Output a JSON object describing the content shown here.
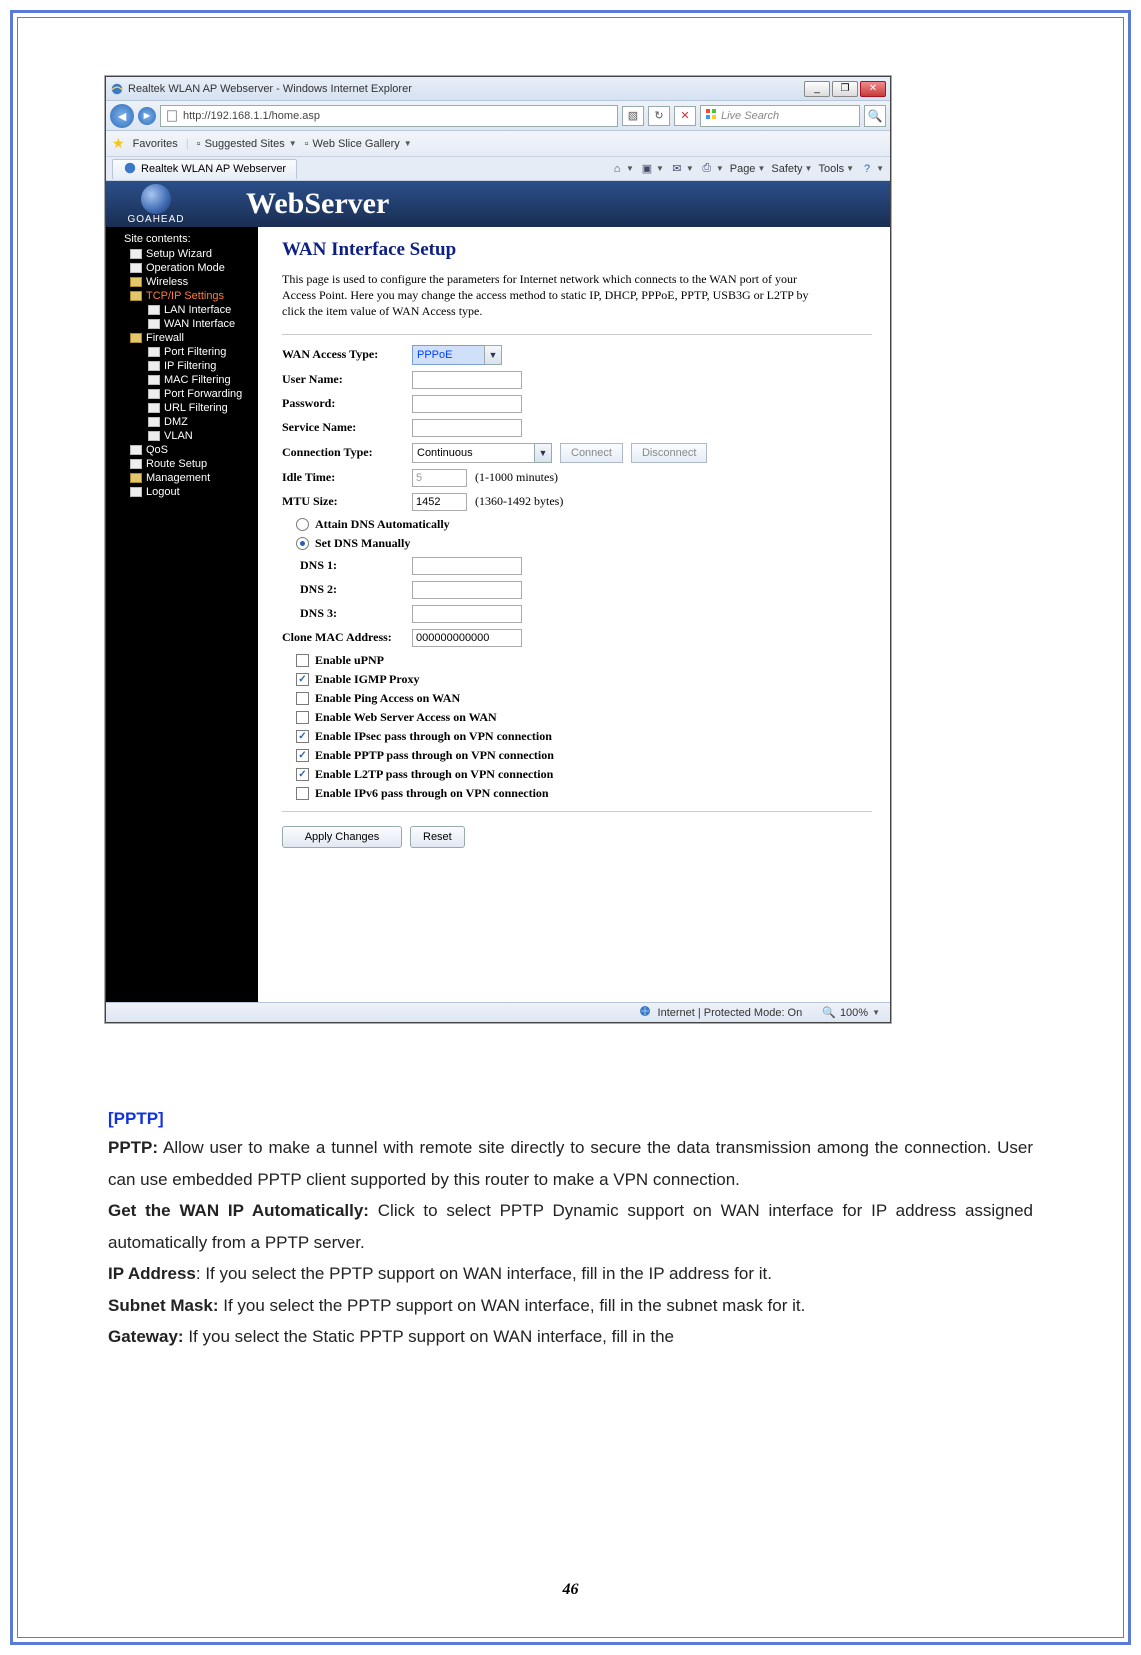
{
  "browser": {
    "title": "Realtek WLAN AP Webserver - Windows Internet Explorer",
    "url": "http://192.168.1.1/home.asp",
    "search_placeholder": "Live Search",
    "favorites_label": "Favorites",
    "suggested_sites_label": "Suggested Sites",
    "web_slice_label": "Web Slice Gallery",
    "tab_title": "Realtek WLAN AP Webserver",
    "tools": {
      "page": "Page",
      "safety": "Safety",
      "tools": "Tools"
    },
    "status_zone": "Internet | Protected Mode: On",
    "zoom": "100%"
  },
  "webserver": {
    "brand_top": "GOAHEAD",
    "brand_title": "WebServer",
    "sidebar_header": "Site contents:",
    "sidebar": [
      {
        "label": "Setup Wizard",
        "lv": 1,
        "icon": "page"
      },
      {
        "label": "Operation Mode",
        "lv": 1,
        "icon": "page"
      },
      {
        "label": "Wireless",
        "lv": 1,
        "icon": "folder"
      },
      {
        "label": "TCP/IP Settings",
        "lv": 1,
        "icon": "folder",
        "active": true
      },
      {
        "label": "LAN Interface",
        "lv": 2,
        "icon": "page"
      },
      {
        "label": "WAN Interface",
        "lv": 2,
        "icon": "page"
      },
      {
        "label": "Firewall",
        "lv": 1,
        "icon": "folder"
      },
      {
        "label": "Port Filtering",
        "lv": 2,
        "icon": "page"
      },
      {
        "label": "IP Filtering",
        "lv": 2,
        "icon": "page"
      },
      {
        "label": "MAC Filtering",
        "lv": 2,
        "icon": "page"
      },
      {
        "label": "Port Forwarding",
        "lv": 2,
        "icon": "page"
      },
      {
        "label": "URL Filtering",
        "lv": 2,
        "icon": "page"
      },
      {
        "label": "DMZ",
        "lv": 2,
        "icon": "page"
      },
      {
        "label": "VLAN",
        "lv": 2,
        "icon": "page"
      },
      {
        "label": "QoS",
        "lv": 1,
        "icon": "page"
      },
      {
        "label": "Route Setup",
        "lv": 1,
        "icon": "page"
      },
      {
        "label": "Management",
        "lv": 1,
        "icon": "folder"
      },
      {
        "label": "Logout",
        "lv": 1,
        "icon": "page"
      }
    ],
    "page_title": "WAN Interface Setup",
    "page_desc": "This page is used to configure the parameters for Internet network which connects to the WAN port of your Access Point. Here you may change the access method to static IP, DHCP, PPPoE, PPTP, USB3G or L2TP by click the item value of WAN Access type.",
    "labels": {
      "wan_access": "WAN Access Type:",
      "user_name": "User Name:",
      "password": "Password:",
      "service_name": "Service Name:",
      "conn_type": "Connection Type:",
      "idle": "Idle Time:",
      "mtu": "MTU Size:",
      "dns_auto": "Attain DNS Automatically",
      "dns_manual": "Set DNS Manually",
      "dns1": "DNS 1:",
      "dns2": "DNS 2:",
      "dns3": "DNS 3:",
      "clone_mac": "Clone MAC Address:",
      "upnp": "Enable uPNP",
      "igmp": "Enable IGMP Proxy",
      "ping": "Enable Ping Access on WAN",
      "websrv": "Enable Web Server Access on WAN",
      "ipsec": "Enable IPsec pass through on VPN connection",
      "pptp": "Enable PPTP pass through on VPN connection",
      "l2tp": "Enable L2TP pass through on VPN connection",
      "ipv6": "Enable IPv6 pass through on VPN connection",
      "connect": "Connect",
      "disconnect": "Disconnect",
      "idle_hint": "(1-1000 minutes)",
      "mtu_hint": "(1360-1492 bytes)",
      "apply": "Apply Changes",
      "reset": "Reset"
    },
    "values": {
      "wan_access": "PPPoE",
      "user_name": "",
      "password": "",
      "service_name": "",
      "conn_type": "Continuous",
      "idle": "5",
      "mtu": "1452",
      "dns1": "",
      "dns2": "",
      "dns3": "",
      "clone_mac": "000000000000",
      "dns_mode": "manual",
      "chk_upnp": false,
      "chk_igmp": true,
      "chk_ping": false,
      "chk_websrv": false,
      "chk_ipsec": true,
      "chk_pptp": true,
      "chk_l2tp": true,
      "chk_ipv6": false
    }
  },
  "doc": {
    "heading": "[PPTP]",
    "p1a": "PPTP:",
    "p1b": " Allow user to make a tunnel with remote site directly to secure the data transmission among the connection. User can use embedded PPTP client supported by this router to make a VPN connection.",
    "p2a": "Get the WAN IP Automatically:",
    "p2b": " Click to select PPTP Dynamic support on WAN interface for IP address assigned automatically from a PPTP server.",
    "p3a": "IP Address",
    "p3b": ": If you select the PPTP support on WAN interface, fill in the IP address for it.",
    "p4a": "Subnet Mask:",
    "p4b": " If you select the PPTP support on WAN interface, fill in the subnet mask for it.",
    "p5a": "Gateway:",
    "p5b": " If you select the Static PPTP support on WAN interface, fill in the"
  },
  "page_number": "46"
}
